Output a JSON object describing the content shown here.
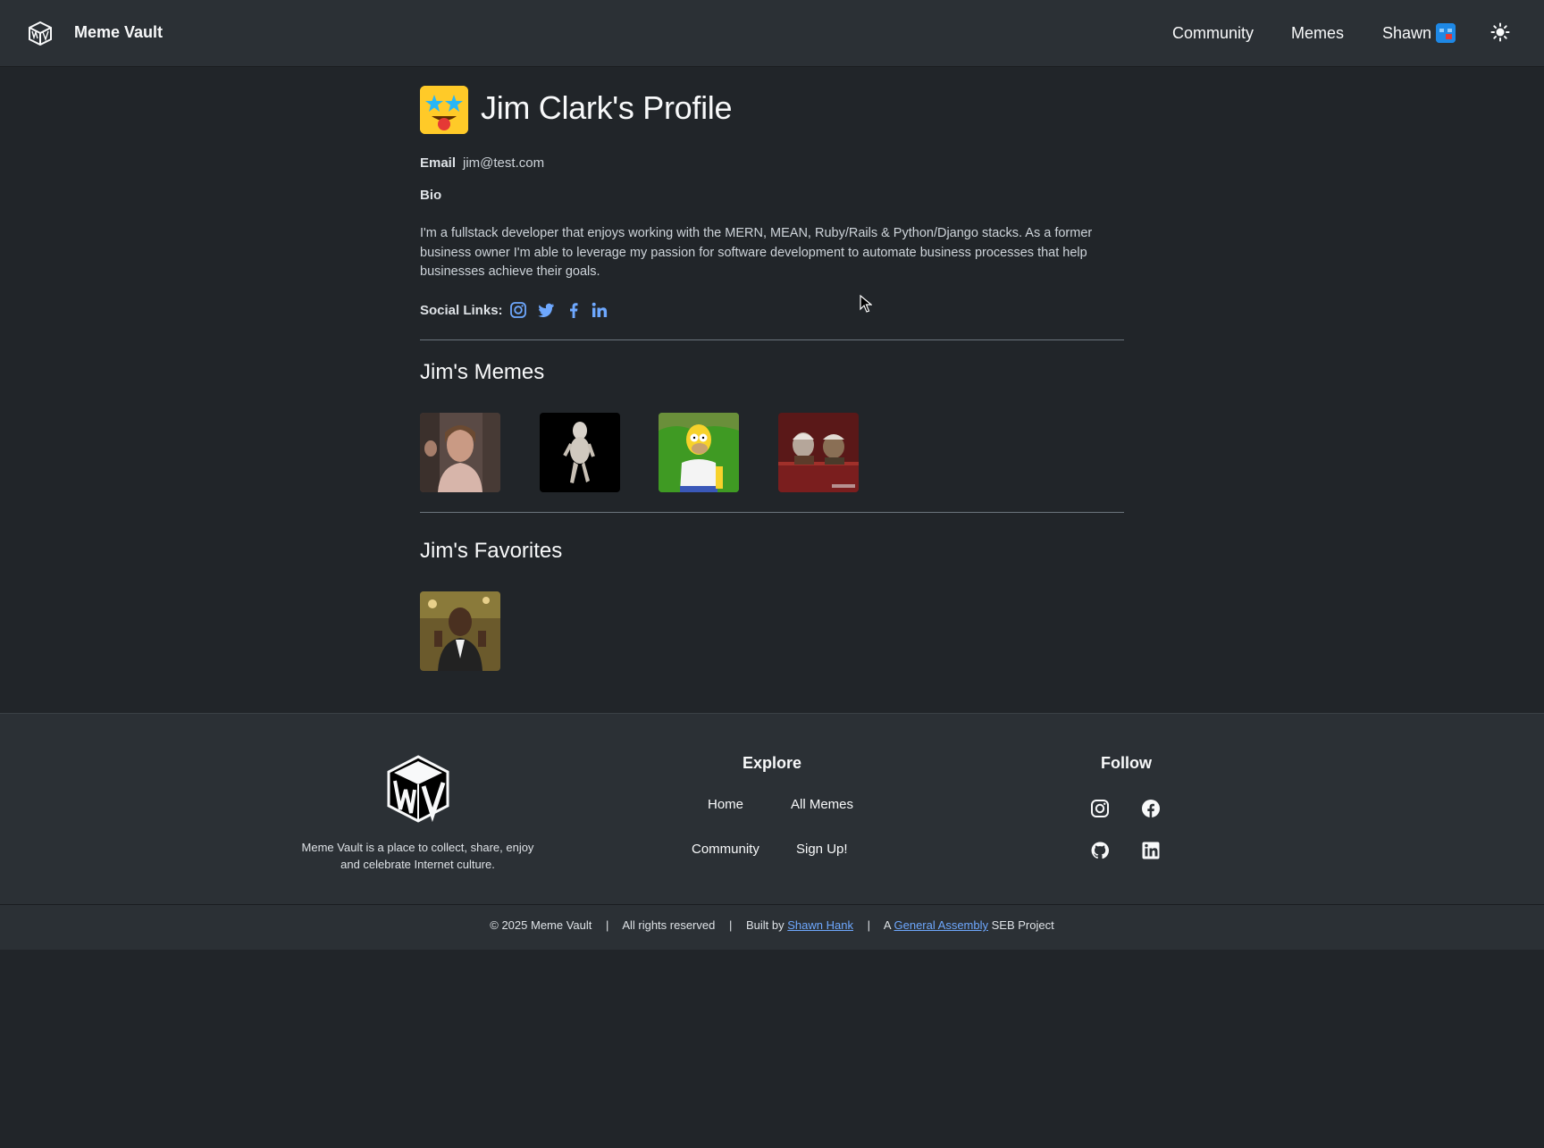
{
  "navbar": {
    "brand": "Meme Vault",
    "links": {
      "community": "Community",
      "memes": "Memes",
      "user": "Shawn"
    }
  },
  "profile": {
    "title": "Jim Clark's Profile",
    "email_label": "Email",
    "email": "jim@test.com",
    "bio_label": "Bio",
    "bio": "I'm a fullstack developer that enjoys working with the MERN, MEAN, Ruby/Rails & Python/Django stacks. As a former business owner I'm able to leverage my passion for software development to automate business processes that help businesses achieve their goals.",
    "social_label": "Social Links:",
    "social_icons": [
      "instagram-icon",
      "twitter-icon",
      "facebook-icon",
      "linkedin-icon"
    ]
  },
  "memes_section": {
    "title": "Jim's Memes"
  },
  "favorites_section": {
    "title": "Jim's Favorites"
  },
  "footer": {
    "tagline": "Meme Vault is a place to collect, share, enjoy and celebrate Internet culture.",
    "explore": {
      "heading": "Explore",
      "links": {
        "home": "Home",
        "all_memes": "All Memes",
        "community": "Community",
        "signup": "Sign Up!"
      }
    },
    "follow": {
      "heading": "Follow",
      "icons": [
        "instagram-icon",
        "facebook-icon",
        "github-icon",
        "linkedin-icon"
      ]
    },
    "copyright": {
      "text": "© 2025 Meme Vault",
      "rights": "All rights reserved",
      "built_by_prefix": "Built by",
      "author": "Shawn Hank",
      "project_prefix": "A",
      "org": "General Assembly",
      "project_suffix": "SEB Project",
      "separator": "|"
    }
  },
  "colors": {
    "background": "#212529",
    "navbar": "#2b3035",
    "link_accent": "#6ea8fe",
    "avatar_yellow": "#ffca28",
    "user_avatar_blue": "#1e88e5"
  }
}
